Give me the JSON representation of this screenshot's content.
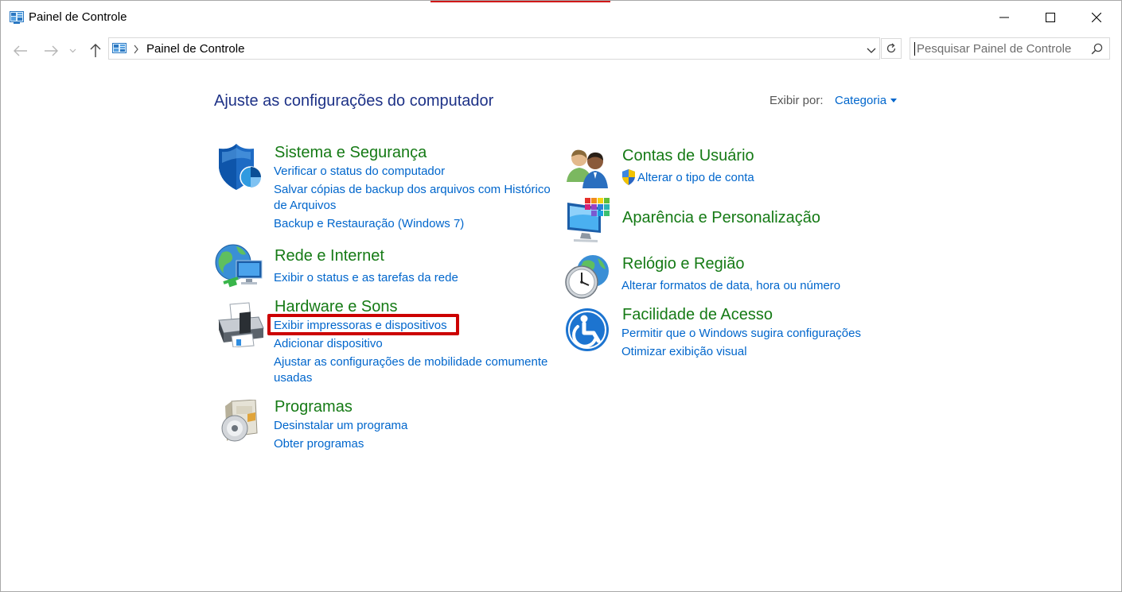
{
  "window": {
    "title": "Painel de Controle"
  },
  "address": {
    "path": "Painel de Controle"
  },
  "search": {
    "placeholder": "Pesquisar Painel de Controle"
  },
  "content": {
    "heading": "Ajuste as configurações do computador",
    "view_by_label": "Exibir por:",
    "view_by_value": "Categoria"
  },
  "categories": {
    "sistema": {
      "title": "Sistema e Segurança",
      "links": [
        "Verificar o status do computador",
        "Salvar cópias de backup dos arquivos com Histórico",
        "de Arquivos",
        "Backup e Restauração (Windows 7)"
      ]
    },
    "rede": {
      "title": "Rede e Internet",
      "links": [
        "Exibir o status e as tarefas da rede"
      ]
    },
    "hardware": {
      "title": "Hardware e Sons",
      "links": [
        "Exibir impressoras e dispositivos",
        "Adicionar dispositivo",
        "Ajustar as configurações de mobilidade comumente",
        "usadas"
      ]
    },
    "programas": {
      "title": "Programas",
      "links": [
        "Desinstalar um programa",
        "Obter programas"
      ]
    },
    "contas": {
      "title": "Contas de Usuário",
      "links": [
        "Alterar o tipo de conta"
      ]
    },
    "aparencia": {
      "title": "Aparência e Personalização",
      "links": []
    },
    "relogio": {
      "title": "Relógio e Região",
      "links": [
        "Alterar formatos de data, hora ou número"
      ]
    },
    "facilidade": {
      "title": "Facilidade de Acesso",
      "links": [
        "Permitir que o Windows sugira configurações",
        "Otimizar exibição visual"
      ]
    }
  },
  "colors": {
    "category_title": "#157a15",
    "link": "#0066cc",
    "heading": "#1e3287",
    "highlight": "#cc0000"
  },
  "icons": {
    "app": "control-panel-icon",
    "sistema": "shield-icon",
    "rede": "network-globe-icon",
    "hardware": "printer-icon",
    "programas": "programs-disc-icon",
    "contas": "users-icon",
    "uac": "uac-shield-icon",
    "aparencia": "monitor-palette-icon",
    "relogio": "clock-globe-icon",
    "facilidade": "accessibility-icon"
  }
}
